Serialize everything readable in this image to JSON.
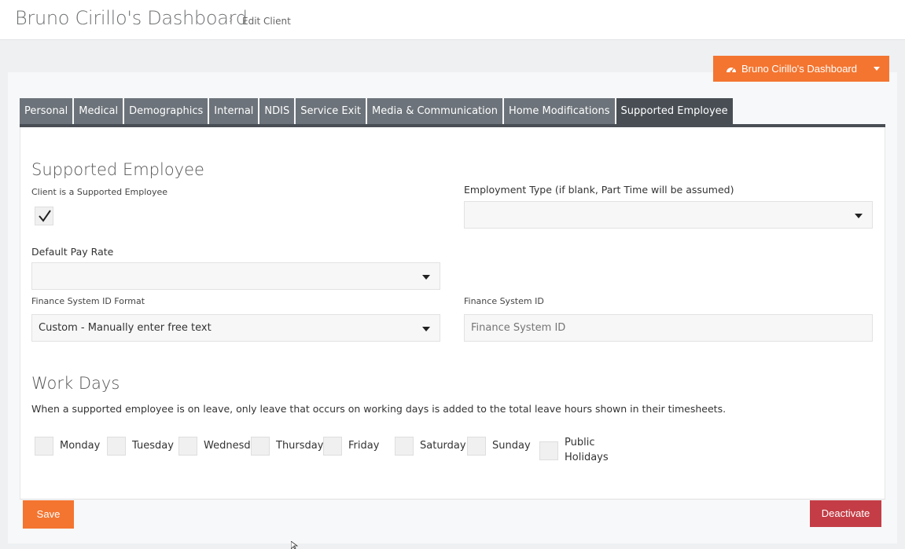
{
  "header": {
    "title": "Bruno Cirillo's Dashboard",
    "breadcrumb_sep": "›",
    "breadcrumb_current": "Edit Client"
  },
  "dashboard_button": {
    "label": "Bruno Cirillo's Dashboard",
    "icon": "dashboard-gauge-icon"
  },
  "tabs": [
    {
      "label": "Personal"
    },
    {
      "label": "Medical"
    },
    {
      "label": "Demographics"
    },
    {
      "label": "Internal"
    },
    {
      "label": "NDIS"
    },
    {
      "label": "Service Exit"
    },
    {
      "label": "Media & Communication"
    },
    {
      "label": "Home Modifications"
    },
    {
      "label": "Supported Employee",
      "active": true
    }
  ],
  "supported_employee": {
    "heading": "Supported Employee",
    "checkbox_label": "Client is a Supported Employee",
    "checkbox_checked": true,
    "employment_type_label": "Employment Type (if blank, Part Time will be assumed)",
    "employment_type_value": "",
    "default_pay_rate_label": "Default Pay Rate",
    "default_pay_rate_value": "",
    "finance_format_label": "Finance System ID Format",
    "finance_format_value": "Custom - Manually enter free text",
    "finance_id_label": "Finance System ID",
    "finance_id_placeholder": "Finance System ID"
  },
  "work_days": {
    "heading": "Work Days",
    "note": "When a supported employee is on leave, only leave that occurs on working days is added to the total leave hours shown in their timesheets.",
    "days": [
      {
        "label": "Monday",
        "checked": false
      },
      {
        "label": "Tuesday",
        "checked": false
      },
      {
        "label": "Wednesday",
        "checked": false
      },
      {
        "label": "Thursday",
        "checked": false
      },
      {
        "label": "Friday",
        "checked": false
      },
      {
        "label": "Saturday",
        "checked": false
      },
      {
        "label": "Sunday",
        "checked": false
      },
      {
        "label": "Public Holidays",
        "line1": "Public",
        "line2": "Holidays",
        "checked": false
      }
    ]
  },
  "actions": {
    "save_label": "Save",
    "deactivate_label": "Deactivate"
  },
  "colors": {
    "accent": "#f47530",
    "danger": "#c43d46",
    "tab": "#6c737a",
    "tab_active": "#484e54"
  }
}
